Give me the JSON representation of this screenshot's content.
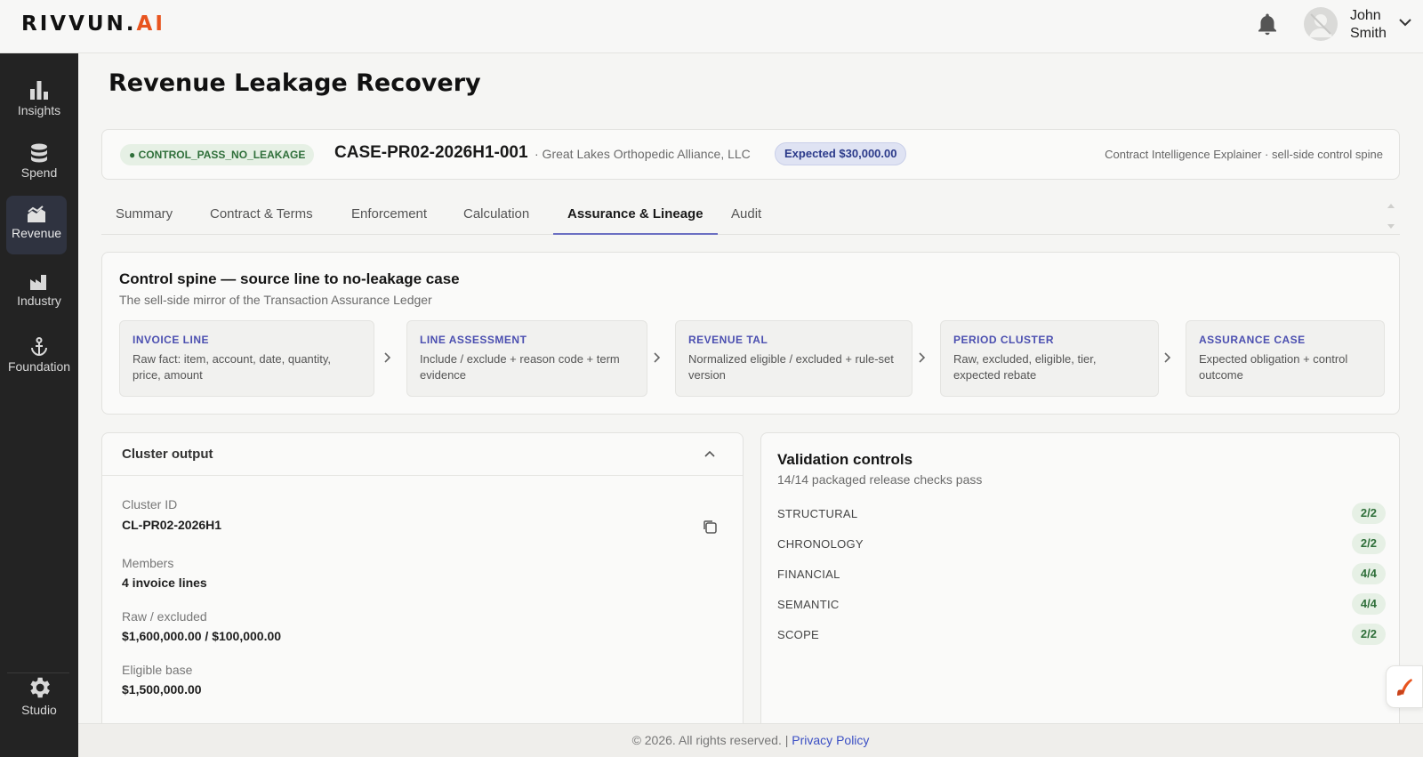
{
  "app": {
    "logo_main": "RIVVUN.",
    "logo_accent": "AI",
    "brand_accent_color": "#e8541e"
  },
  "user": {
    "first_name": "John",
    "last_name": "Smith",
    "icons": [
      "bell-icon",
      "avatar",
      "chevron-down-icon"
    ]
  },
  "sidebar": {
    "items": [
      {
        "label": "Insights",
        "icon": "bar-chart-icon"
      },
      {
        "label": "Spend",
        "icon": "coins-icon"
      },
      {
        "label": "Revenue",
        "icon": "revenue-icon",
        "active": true
      },
      {
        "label": "Industry",
        "icon": "factory-icon"
      },
      {
        "label": "Foundation",
        "icon": "anchor-icon"
      }
    ],
    "studio": {
      "label": "Studio",
      "icon": "gear-icon"
    }
  },
  "page": {
    "title": "Revenue Leakage Recovery"
  },
  "case": {
    "status": "CONTROL_PASS_NO_LEAKAGE",
    "id": "CASE-PR02-2026H1-001",
    "org": "· Great Lakes Orthopedic Alliance, LLC",
    "expected": "Expected $30,000.00",
    "explainer": "Contract Intelligence Explainer · sell-side control spine"
  },
  "tabs": [
    "Summary",
    "Contract & Terms",
    "Enforcement",
    "Calculation",
    "Assurance & Lineage",
    "Audit"
  ],
  "active_tab": "Assurance & Lineage",
  "spine": {
    "title": "Control spine — source line to no-leakage case",
    "subtitle": "The sell-side mirror of the Transaction Assurance Ledger",
    "steps": [
      {
        "title": "INVOICE LINE",
        "desc": "Raw fact: item, account, date, quantity, price, amount"
      },
      {
        "title": "LINE ASSESSMENT",
        "desc": "Include / exclude + reason code + term evidence"
      },
      {
        "title": "REVENUE TAL",
        "desc": "Normalized eligible / excluded + rule-set version"
      },
      {
        "title": "PERIOD CLUSTER",
        "desc": "Raw, excluded, eligible, tier, expected rebate"
      },
      {
        "title": "ASSURANCE CASE",
        "desc": "Expected obligation + control outcome"
      }
    ]
  },
  "cluster": {
    "title": "Cluster output",
    "fields": [
      {
        "label": "Cluster ID",
        "value": "CL-PR02-2026H1"
      },
      {
        "label": "Members",
        "value": "4 invoice lines"
      },
      {
        "label": "Raw / excluded",
        "value": "$1,600,000.00 / $100,000.00"
      },
      {
        "label": "Eligible base",
        "value": "$1,500,000.00"
      }
    ]
  },
  "validation": {
    "title": "Validation controls",
    "subtitle": "14/14 packaged release checks pass",
    "checks": [
      {
        "name": "STRUCTURAL",
        "count": "2/2"
      },
      {
        "name": "CHRONOLOGY",
        "count": "2/2"
      },
      {
        "name": "FINANCIAL",
        "count": "4/4"
      },
      {
        "name": "SEMANTIC",
        "count": "4/4"
      },
      {
        "name": "SCOPE",
        "count": "2/2"
      }
    ]
  },
  "footer": {
    "copyright": "© 2026. All rights reserved. |",
    "link": "Privacy Policy"
  }
}
